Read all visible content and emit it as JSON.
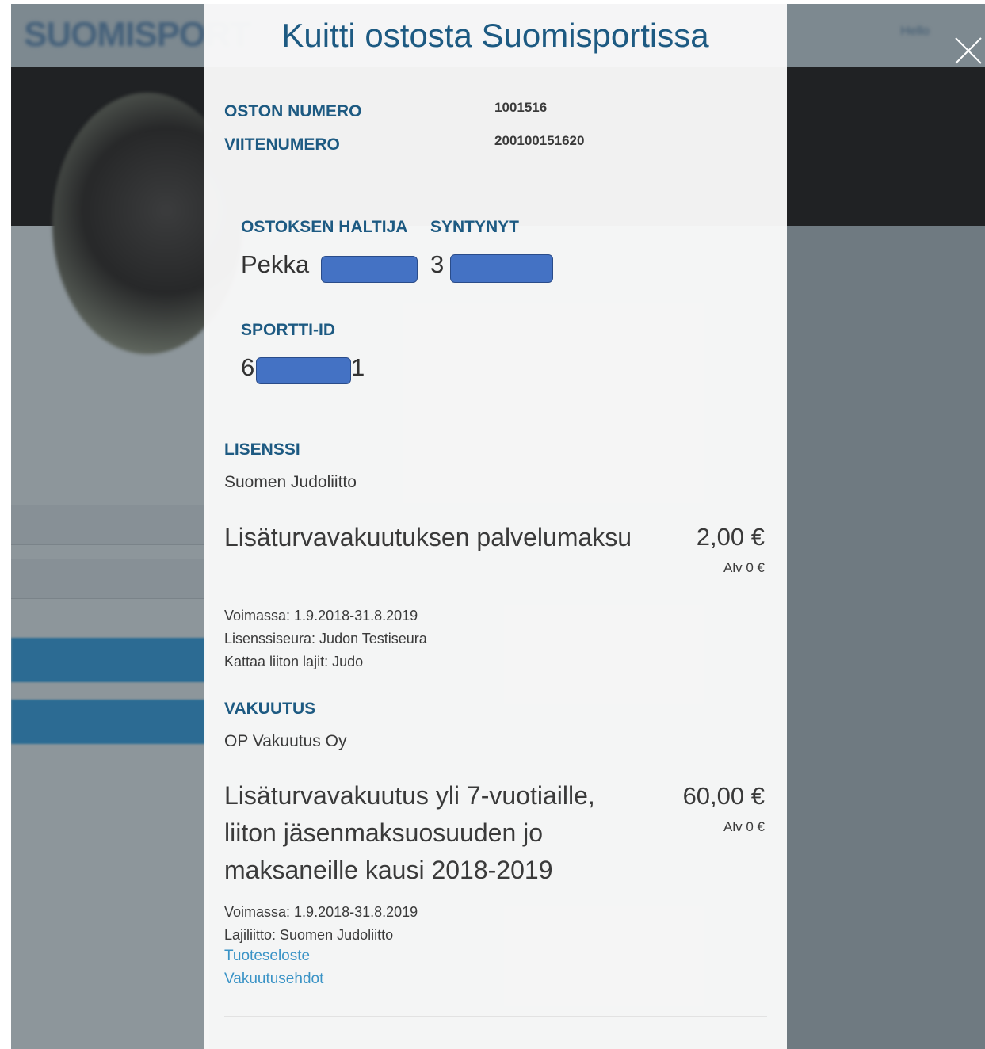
{
  "background": {
    "logo": "SUOMISPORT",
    "nav_text": "Hello"
  },
  "modal": {
    "title": "Kuitti ostosta Suomisportissa",
    "order_number_label": "OSTON NUMERO",
    "order_number": "1001516",
    "reference_label": "VIITENUMERO",
    "reference": "200100151620",
    "holder_label": "OSTOKSEN HALTIJA",
    "holder_name": "Pekka",
    "born_label": "SYNTYNYT",
    "born_value": "3",
    "sportti_label": "SPORTTI-ID",
    "sportti_prefix": "6",
    "sportti_suffix": "1",
    "sections": [
      {
        "label": "LISENSSI",
        "provider": "Suomen Judoliitto",
        "product": "Lisäturvavakuutuksen palvelumaksu",
        "price": "2,00 €",
        "vat": "Alv 0 €",
        "details": [
          "Voimassa: 1.9.2018-31.8.2019",
          "Lisenssiseura: Judon Testiseura",
          "Kattaa liiton lajit: Judo"
        ]
      },
      {
        "label": "VAKUUTUS",
        "provider": "OP Vakuutus Oy",
        "product": "Lisäturvavakuutus yli 7-vuotiaille, liiton jäsenmaksuosuuden jo maksaneille kausi 2018-2019",
        "price": "60,00 €",
        "vat": "Alv 0 €",
        "details": [
          "Voimassa: 1.9.2018-31.8.2019",
          "Lajiliitto: Suomen Judoliitto"
        ],
        "links": [
          "Tuoteseloste",
          "Vakuutusehdot"
        ]
      }
    ]
  },
  "colors": {
    "accent": "#1d5a82",
    "link": "#3a93c6",
    "redaction": "#4472c4",
    "overlay": "#6f7a81"
  }
}
